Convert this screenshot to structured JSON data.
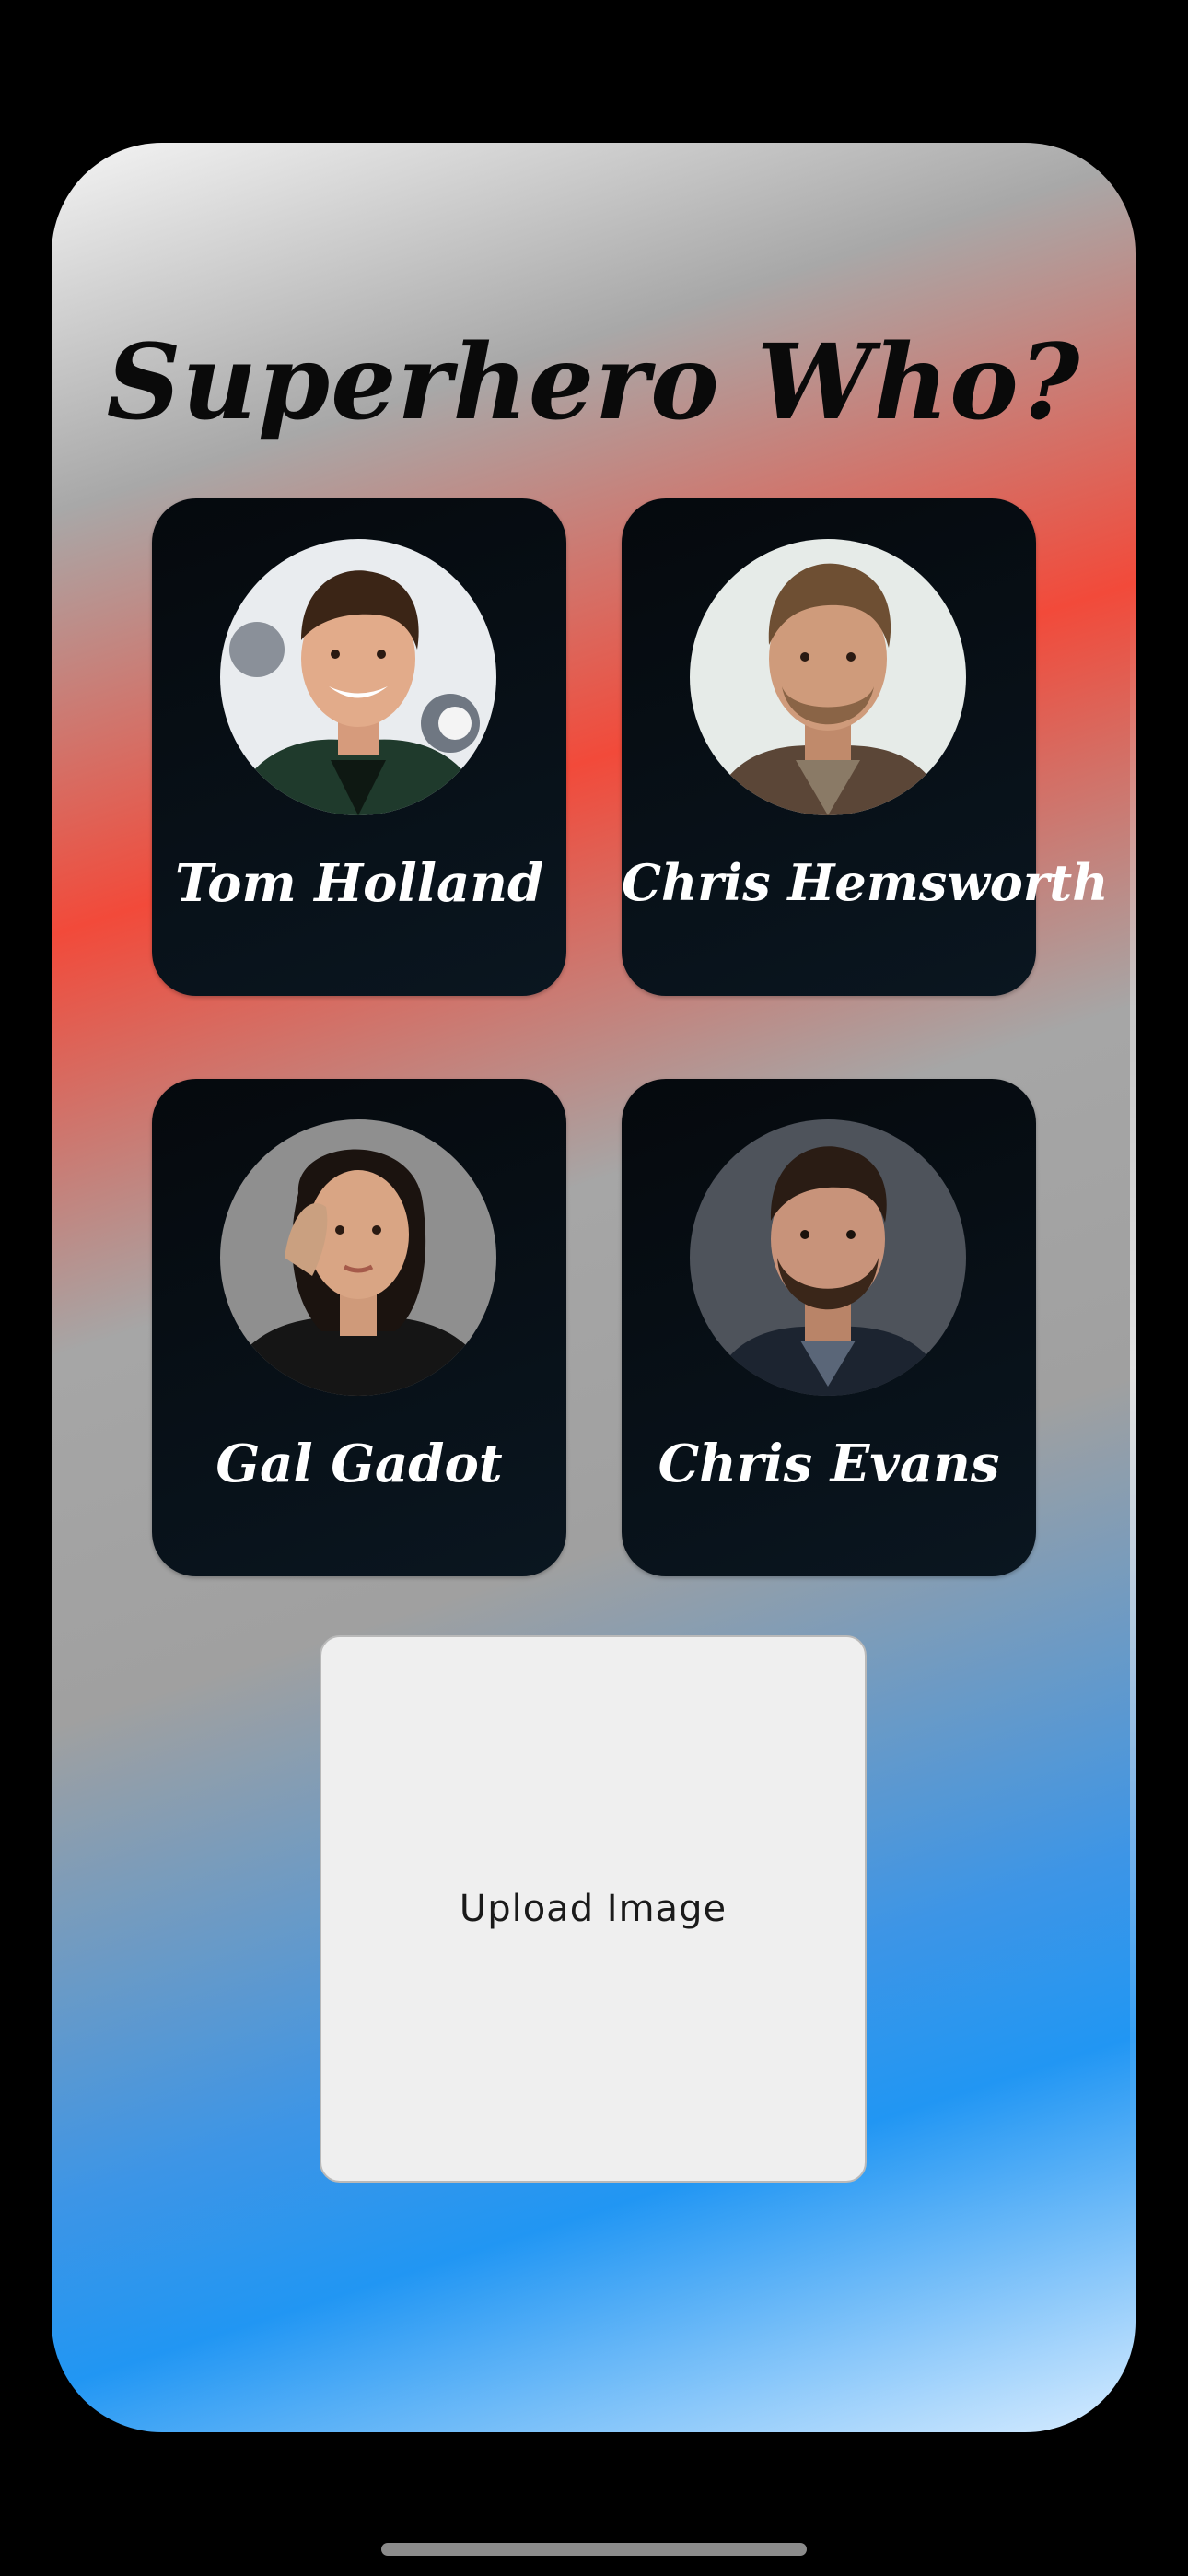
{
  "app": {
    "title": "Superhero Who?"
  },
  "heroes": [
    {
      "name": "Tom Holland",
      "icon": "tom-holland-photo"
    },
    {
      "name": "Chris Hemsworth",
      "icon": "chris-hemsworth-photo"
    },
    {
      "name": "Gal Gadot",
      "icon": "gal-gadot-photo"
    },
    {
      "name": "Chris Evans",
      "icon": "chris-evans-photo"
    }
  ],
  "upload": {
    "label": "Upload Image"
  },
  "colors": {
    "background_black": "#000000",
    "card_dark": "#07111a",
    "gradient_red": "#f24a3a",
    "gradient_grey": "#a6a6a6",
    "gradient_blue": "#2196f3",
    "upload_bg": "#efefef"
  }
}
